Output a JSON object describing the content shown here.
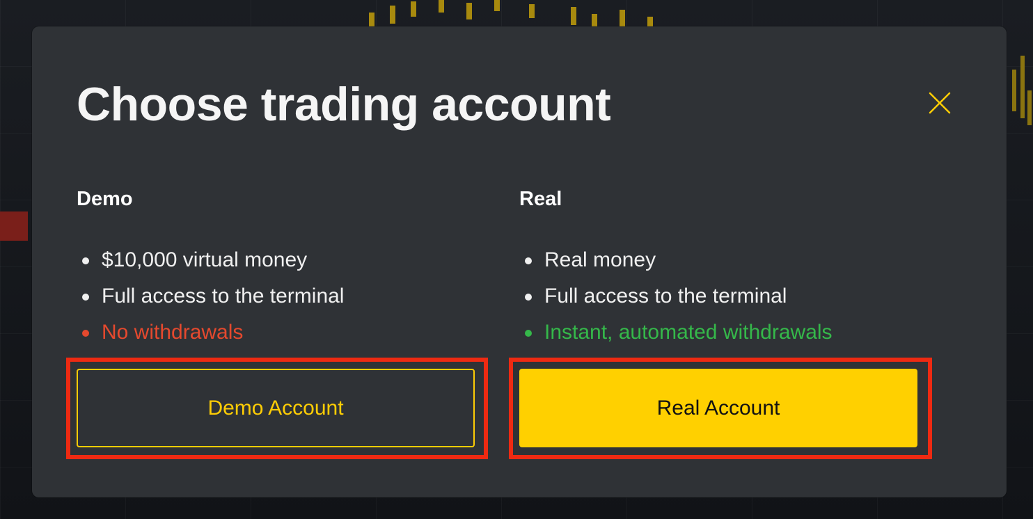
{
  "dialog": {
    "title": "Choose trading account",
    "close_icon": "close-icon"
  },
  "demo": {
    "heading": "Demo",
    "features": [
      {
        "text": "$10,000 virtual money",
        "status": "neutral"
      },
      {
        "text": "Full access to the terminal",
        "status": "neutral"
      },
      {
        "text": "No withdrawals",
        "status": "negative"
      }
    ],
    "button_label": "Demo Account"
  },
  "real": {
    "heading": "Real",
    "features": [
      {
        "text": "Real money",
        "status": "neutral"
      },
      {
        "text": "Full access to the terminal",
        "status": "neutral"
      },
      {
        "text": "Instant, automated withdrawals",
        "status": "positive"
      }
    ],
    "button_label": "Real Account"
  },
  "colors": {
    "modal_bg": "#2f3236",
    "accent": "#ffd000",
    "negative": "#e5492e",
    "positive": "#35b84a",
    "highlight": "#ee2a12"
  }
}
